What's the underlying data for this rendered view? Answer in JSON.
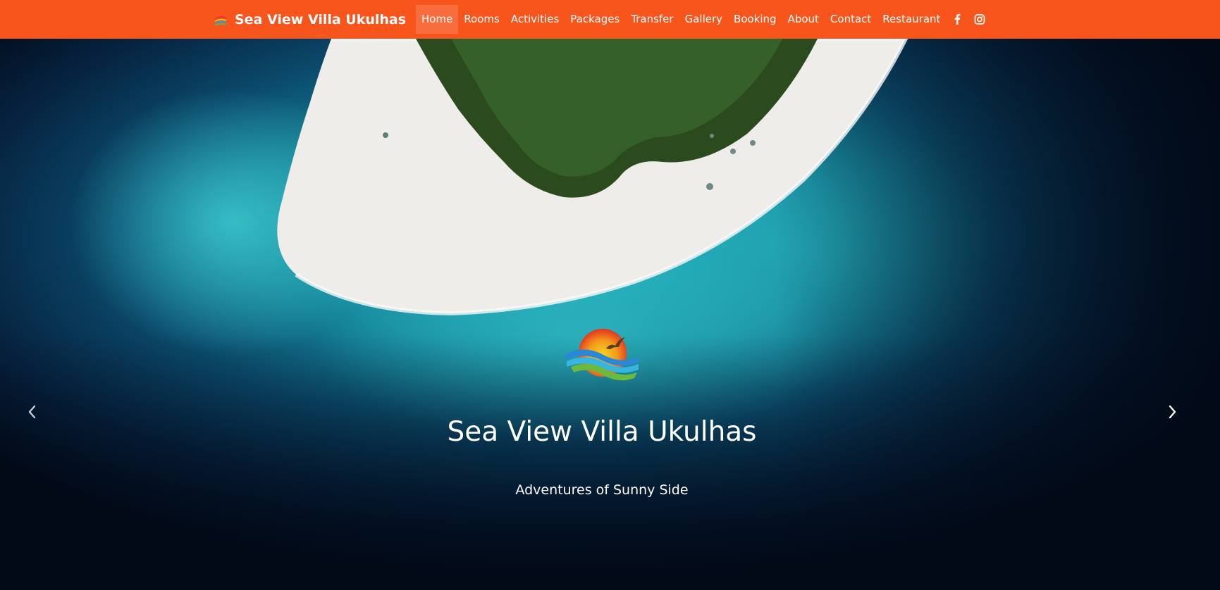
{
  "brand": {
    "name": "Sea View Villa Ukulhas"
  },
  "nav": {
    "items": [
      {
        "label": "Home",
        "active": true
      },
      {
        "label": "Rooms"
      },
      {
        "label": "Activities"
      },
      {
        "label": "Packages"
      },
      {
        "label": "Transfer"
      },
      {
        "label": "Gallery"
      },
      {
        "label": "Booking"
      },
      {
        "label": "About"
      },
      {
        "label": "Contact"
      },
      {
        "label": "Restaurant"
      }
    ],
    "social": [
      "facebook-icon",
      "instagram-icon"
    ]
  },
  "hero": {
    "title": "Sea View Villa Ukulhas",
    "subtitle": "Adventures of Sunny Side",
    "controls": [
      "chevron-left-icon",
      "chevron-right-icon"
    ]
  },
  "colors": {
    "nav_bg": "#f8551d",
    "text": "#ffffff",
    "ocean_deep": "#020a18",
    "lagoon": "#1fb3bf",
    "sand": "#f2f1ee",
    "forest": "#2b4a1e"
  }
}
